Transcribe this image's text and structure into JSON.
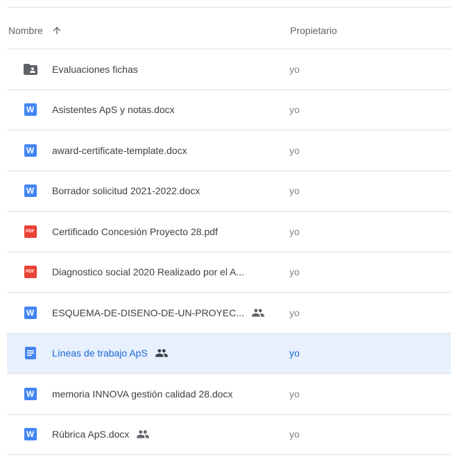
{
  "header": {
    "name_label": "Nombre",
    "owner_label": "Propietario",
    "sort_icon": "arrow-up-icon"
  },
  "files": [
    {
      "name": "Evaluaciones fichas",
      "owner": "yo",
      "icon": "shared-folder-icon",
      "shared": false,
      "selected": false
    },
    {
      "name": "Asistentes ApS y notas.docx",
      "owner": "yo",
      "icon": "word-icon",
      "icon_text": "W",
      "shared": false,
      "selected": false
    },
    {
      "name": "award-certificate-template.docx",
      "owner": "yo",
      "icon": "word-icon",
      "icon_text": "W",
      "shared": false,
      "selected": false
    },
    {
      "name": "Borrador solicitud 2021-2022.docx",
      "owner": "yo",
      "icon": "word-icon",
      "icon_text": "W",
      "shared": false,
      "selected": false
    },
    {
      "name": "Certificado Concesión Proyecto 28.pdf",
      "owner": "yo",
      "icon": "pdf-icon",
      "icon_text": "PDF",
      "shared": false,
      "selected": false
    },
    {
      "name": "Diagnostico social 2020 Realizado por el A...",
      "owner": "yo",
      "icon": "pdf-icon",
      "icon_text": "PDF",
      "shared": false,
      "selected": false
    },
    {
      "name": "ESQUEMA-DE-DISENO-DE-UN-PROYEC...",
      "owner": "yo",
      "icon": "word-icon",
      "icon_text": "W",
      "shared": true,
      "selected": false
    },
    {
      "name": "Líneas de trabajo ApS",
      "owner": "yo",
      "icon": "google-doc-icon",
      "shared": true,
      "selected": true
    },
    {
      "name": "memoria INNOVA gestión calidad 28.docx",
      "owner": "yo",
      "icon": "word-icon",
      "icon_text": "W",
      "shared": false,
      "selected": false
    },
    {
      "name": "Rúbrica ApS.docx",
      "owner": "yo",
      "icon": "word-icon",
      "icon_text": "W",
      "shared": true,
      "selected": false
    }
  ],
  "colors": {
    "word": "#4285f4",
    "pdf": "#ea4335",
    "folder": "#5f6368",
    "selected_bg": "#e8f0fe",
    "selected_text": "#1967d2"
  }
}
